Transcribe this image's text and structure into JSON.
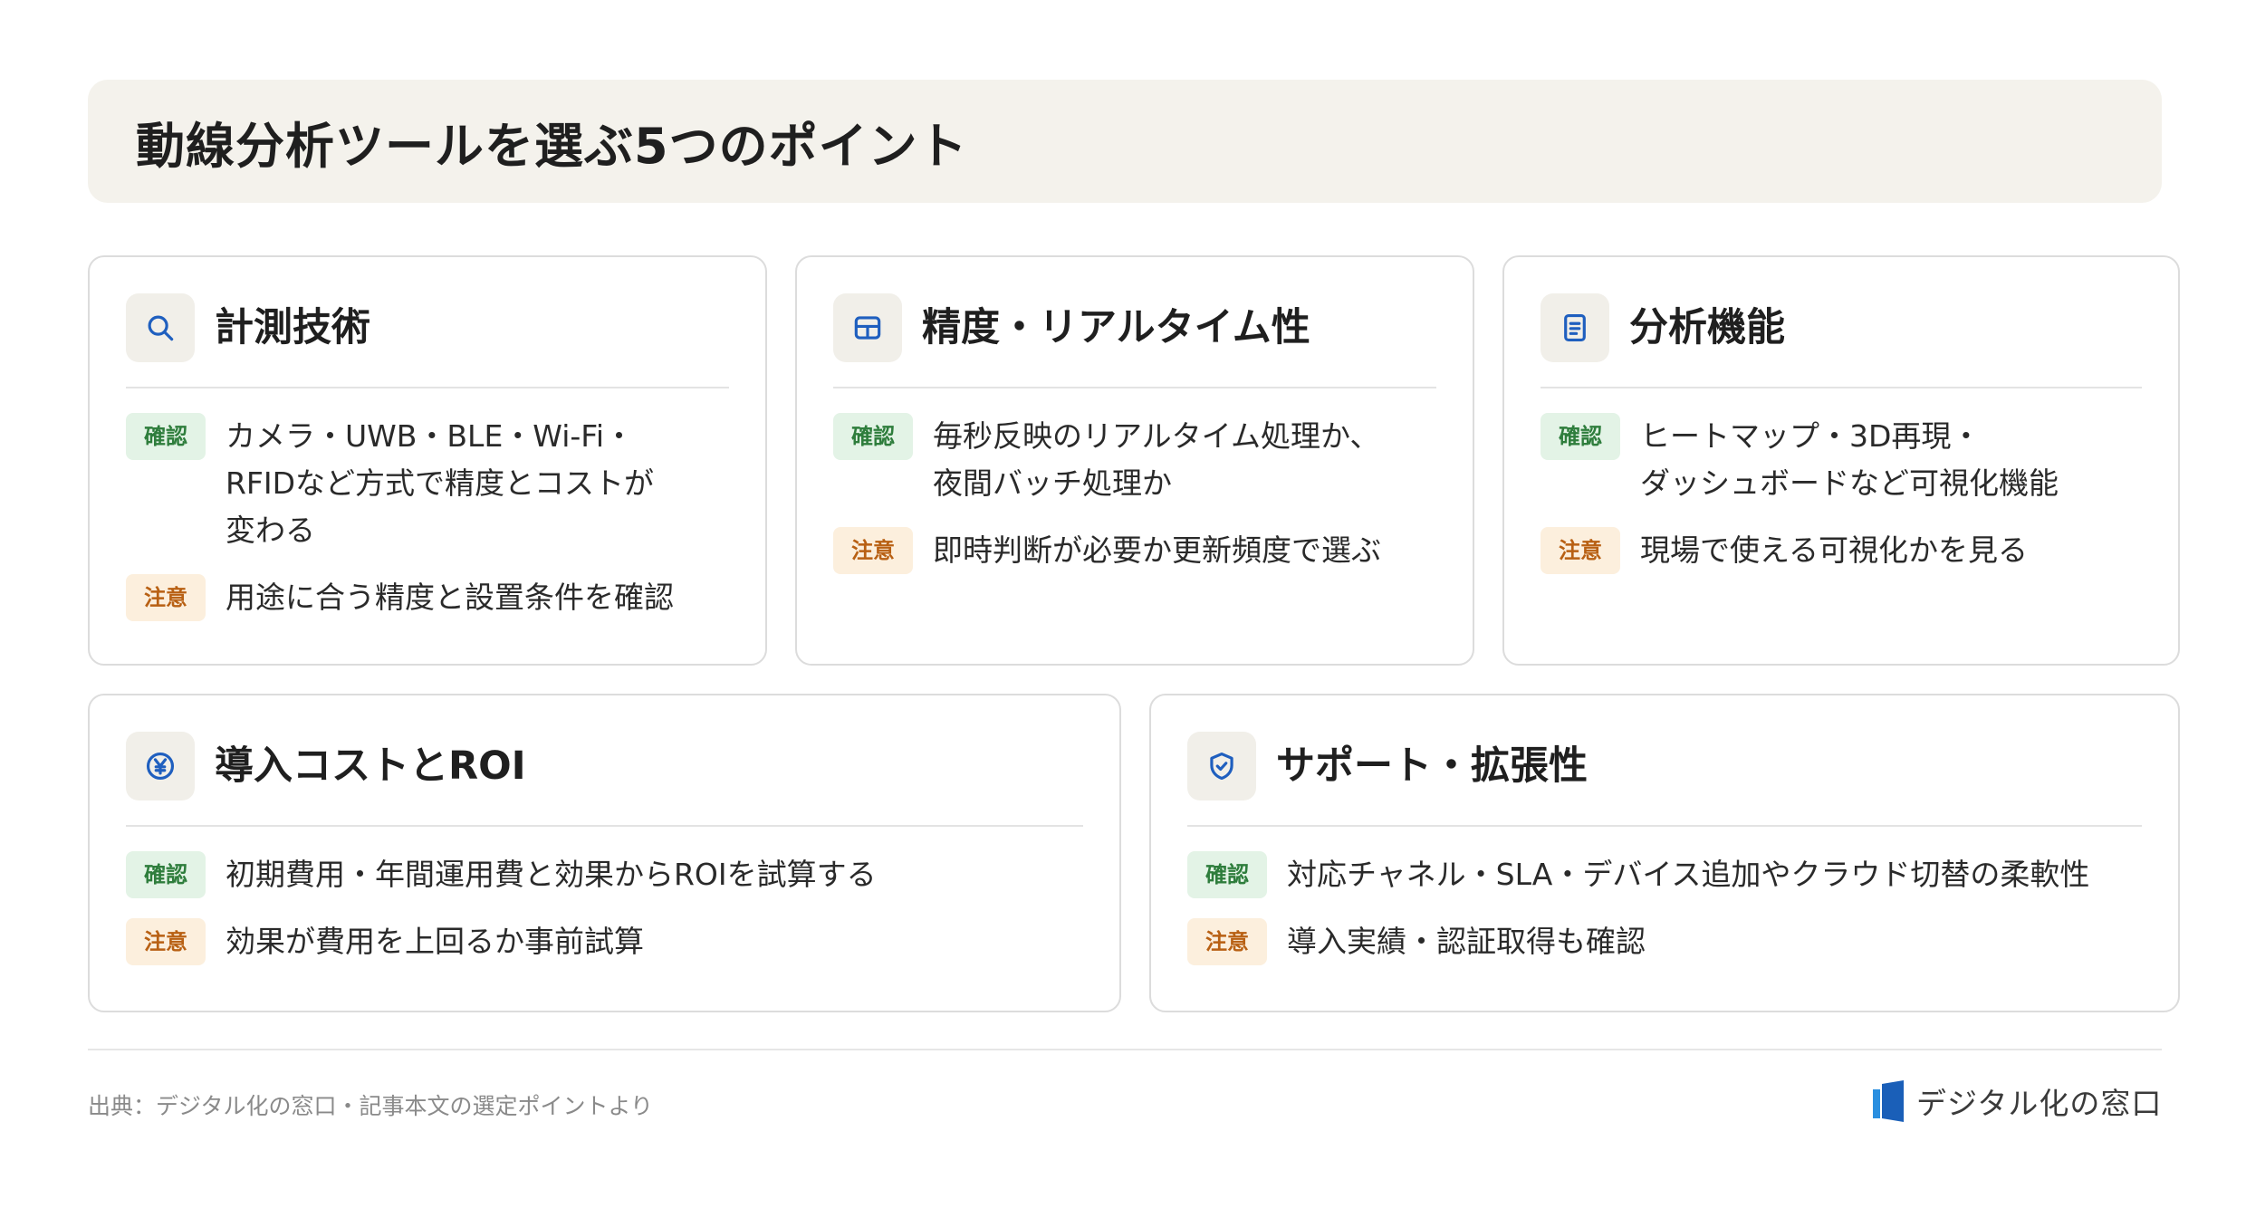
{
  "title": "動線分析ツールを選ぶ5つのポイント",
  "badges": {
    "check": "確認",
    "note": "注意"
  },
  "cards": [
    {
      "title": "計測技術",
      "icon": "search-icon",
      "check": [
        "カメラ・UWB・BLE・Wi-Fi・",
        "RFIDなど方式で精度とコストが",
        "変わる"
      ],
      "note": "用途に合う精度と設置条件を確認"
    },
    {
      "title": "精度・リアルタイム性",
      "icon": "grid-icon",
      "check": [
        "毎秒反映のリアルタイム処理か、",
        "夜間バッチ処理か"
      ],
      "note": "即時判断が必要か更新頻度で選ぶ"
    },
    {
      "title": "分析機能",
      "icon": "document-icon",
      "check": [
        "ヒートマップ・3D再現・",
        "ダッシュボードなど可視化機能"
      ],
      "note": "現場で使える可視化かを見る"
    },
    {
      "title": "導入コストとROI",
      "icon": "yen-icon",
      "check": [
        "初期費用・年間運用費と効果からROIを試算する"
      ],
      "note": "効果が費用を上回るか事前試算"
    },
    {
      "title": "サポート・拡張性",
      "icon": "shield-icon",
      "check": [
        "対応チャネル・SLA・デバイス追加やクラウド切替の柔軟性"
      ],
      "note": "導入実績・認証取得も確認"
    }
  ],
  "footer": {
    "source": "出典：デジタル化の窓口・記事本文の選定ポイントより",
    "brand": "デジタル化の窓口"
  },
  "colors": {
    "accent_blue": "#1f5fbf",
    "check_bg": "#e3f3e6",
    "check_text": "#2e7d3c",
    "note_bg": "#fcefdd",
    "note_text": "#b86013",
    "header_bg": "#f4f2ec"
  }
}
